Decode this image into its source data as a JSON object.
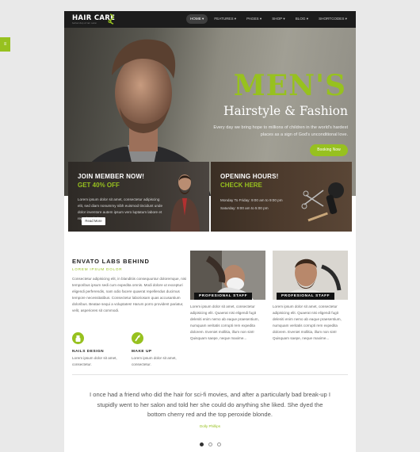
{
  "side_tab": {
    "label": "≡"
  },
  "header": {
    "logo": "HAIR CARE",
    "logo_tagline": "barbershop & hair salon",
    "nav": [
      {
        "label": "HOME ▾",
        "active": true
      },
      {
        "label": "FEATURES ▾",
        "active": false
      },
      {
        "label": "PAGES ▾",
        "active": false
      },
      {
        "label": "SHOP ▾",
        "active": false
      },
      {
        "label": "BLOG ▾",
        "active": false
      },
      {
        "label": "SHORTCODES ▾",
        "active": false
      }
    ]
  },
  "hero": {
    "title_line1": "MEN'S",
    "title_line2": "Hairstyle & Fashion",
    "text": "Every day we bring hope to millions of children in the world's hardest places as a sign of God's unconditional love.",
    "button": "Booking Now"
  },
  "promo_member": {
    "title": "JOIN MEMBER NOW!",
    "subtitle": "GET 40% OFF",
    "text": "Lorem ipsum dolor sit amet, consectetur adipiscing elit, sed diam nonummy nibh euismod tincidunt unde dolor inventore autem ipsum vero luptatum labore et reprehenderit.",
    "button": "Read More"
  },
  "promo_hours": {
    "title": "OPENING HOURS!",
    "subtitle": "CHECK HERE",
    "line1": "Monday To Friday: 9:00 am to 9:00 pm",
    "line2": "Saturday: 9:00 am to 5:00 pm"
  },
  "about": {
    "title": "ENVATO LABS BEHIND",
    "subtitle": "LOREM IPSUM DOLOR",
    "text": "Consectetur adipisicing elit, in blanditiis consequuntur doloremque, nisi temporibus ipsum sedi cum expedita omnis. Modi dolore ut excepturi eligendi perferendis, nam odio facere quaerat repellendus ducimus tempore necessitatibus. Consectetur laboriosam quas accusantium doloribus. Beatae sequi a voluptates! Harum porro provident pariatur, velit, asperiores sit commodi."
  },
  "features": [
    {
      "title": "NAILS DESIGN",
      "text": "Lorem ipsum dolor sit amet, consectetur."
    },
    {
      "title": "MAKE UP",
      "text": "Lorem ipsum dolor sit amet, consectetur."
    }
  ],
  "staff": [
    {
      "label": "PROFESIONAL STAFF",
      "text": "Lorem ipsum dolor sit amet, consectetur adipisicing elit. Quaerat nisi eligendi fugit deleniti enim nemo ab eaque praesentium, numquam veritatis corrupti rem expedita dolorem. Eveniet mollitia, illum non sint! Quisquam saepe, neque maxime..."
    },
    {
      "label": "PROFESIONAL STAFF",
      "text": "Lorem ipsum dolor sit amet, consectetur adipisicing elit. Quaerat nisi eligendi fugit deleniti enim nemo ab eaque praesentium, numquam veritatis corrupti rem expedita dolorem. Eveniet mollitia, illum non sint! Quisquam saepe, neque maxime..."
    }
  ],
  "testimonial": {
    "quote": "I once had a friend who did the hair for sci-fi movies, and after a particularly bad break-up I stupidly went to her salon and told her she could do anything she liked. She dyed the bottom cherry red and the top peroxide blonde.",
    "author": "Dolly Phillips",
    "active_slide": 1,
    "slide_count": 3
  },
  "colors": {
    "accent": "#97c11f",
    "dark": "#1c1c1c"
  }
}
